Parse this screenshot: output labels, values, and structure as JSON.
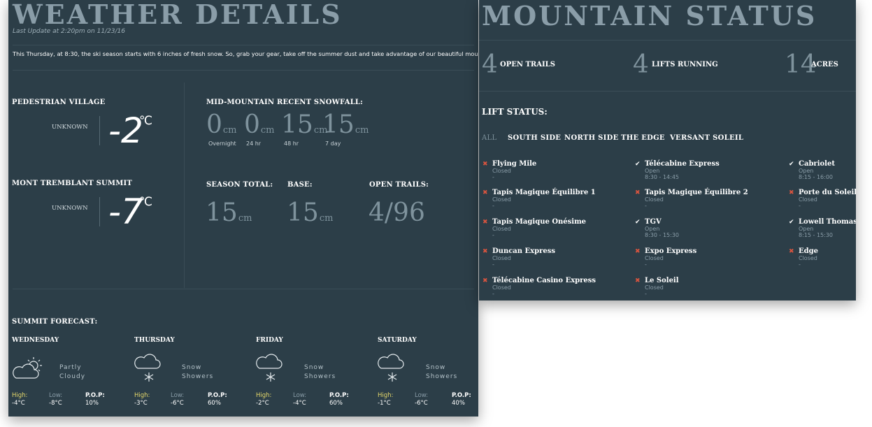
{
  "colors": {
    "panel": "#2c3e48",
    "open": "#ffffff",
    "closed": "#d9543f",
    "high_label": "#e7d96b"
  },
  "weather": {
    "title": "WEATHER DETAILS",
    "last_update": "Last Update at 2:20pm on 11/23/16",
    "announcement": "This Thursday, at 8:30, the ski season starts with 6 inches of fresh snow. So, grab your gear, take off the summer dust and take advantage of our beautiful mountain!",
    "village": {
      "label": "PEDESTRIAN VILLAGE",
      "condition": "UNKNOWN",
      "temp": "-2",
      "unit": "℃"
    },
    "summit": {
      "label": "MONT TREMBLANT SUMMIT",
      "condition": "UNKNOWN",
      "temp": "-7",
      "unit": "℃"
    },
    "snowfall": {
      "label": "MID-MOUNTAIN RECENT SNOWFALL:",
      "items": [
        {
          "value": "0",
          "unit": "cm",
          "period": "Overnight"
        },
        {
          "value": "0",
          "unit": "cm",
          "period": "24 hr"
        },
        {
          "value": "15",
          "unit": "cm",
          "period": "48 hr"
        },
        {
          "value": "15",
          "unit": "cm",
          "period": "7 day"
        }
      ]
    },
    "season_total": {
      "label": "SEASON TOTAL:",
      "value": "15",
      "unit": "cm"
    },
    "base": {
      "label": "BASE:",
      "value": "15",
      "unit": "cm"
    },
    "open_trails": {
      "label": "OPEN TRAILS:",
      "value": "4/96"
    },
    "forecast": {
      "label": "SUMMIT FORECAST:",
      "days": [
        {
          "day": "WEDNESDAY",
          "icon": "partly-cloudy-icon",
          "desc1": "Partly",
          "desc2": "Cloudy",
          "high_label": "High:",
          "high": "-4°C",
          "low_label": "Low:",
          "low": "-8°C",
          "pop_label": "P.O.P:",
          "pop": "10%"
        },
        {
          "day": "THURSDAY",
          "icon": "snow-showers-icon",
          "desc1": "Snow",
          "desc2": "Showers",
          "high_label": "High:",
          "high": "-3°C",
          "low_label": "Low:",
          "low": "-6°C",
          "pop_label": "P.O.P:",
          "pop": "60%"
        },
        {
          "day": "FRIDAY",
          "icon": "snow-showers-icon",
          "desc1": "Snow",
          "desc2": "Showers",
          "high_label": "High:",
          "high": "-2°C",
          "low_label": "Low:",
          "low": "-4°C",
          "pop_label": "P.O.P:",
          "pop": "60%"
        },
        {
          "day": "SATURDAY",
          "icon": "snow-showers-icon",
          "desc1": "Snow",
          "desc2": "Showers",
          "high_label": "High:",
          "high": "-1°C",
          "low_label": "Low:",
          "low": "-6°C",
          "pop_label": "P.O.P:",
          "pop": "40%"
        }
      ]
    }
  },
  "mountain": {
    "title": "MOUNTAIN STATUS",
    "stats": [
      {
        "value": "4",
        "label": "OPEN TRAILS"
      },
      {
        "value": "4",
        "label": "LIFTS RUNNING"
      },
      {
        "value": "14",
        "label": "ACRES"
      }
    ],
    "lift_status_label": "LIFT STATUS:",
    "tabs": [
      "ALL",
      "SOUTH SIDE",
      "NORTH SIDE",
      "THE EDGE",
      "VERSANT SOLEIL"
    ],
    "lifts": [
      {
        "name": "Flying Mile",
        "status": "Closed",
        "hours": "-",
        "open": false
      },
      {
        "name": "Télécabine Express",
        "status": "Open",
        "hours": "8:30 - 14:45",
        "open": true
      },
      {
        "name": "Cabriolet",
        "status": "Open",
        "hours": "8:15 - 16:00",
        "open": true
      },
      {
        "name": "Tapis Magique Équilibre 1",
        "status": "Closed",
        "hours": "-",
        "open": false
      },
      {
        "name": "Tapis Magique Équilibre 2",
        "status": "Closed",
        "hours": "-",
        "open": false
      },
      {
        "name": "Porte du Soleil",
        "status": "Closed",
        "hours": "-",
        "open": false
      },
      {
        "name": "Tapis Magique Onésime",
        "status": "Closed",
        "hours": "-",
        "open": false
      },
      {
        "name": "TGV",
        "status": "Open",
        "hours": "8:30 - 15:30",
        "open": true
      },
      {
        "name": "Lowell Thomas",
        "status": "Open",
        "hours": "8:15 - 15:30",
        "open": true
      },
      {
        "name": "Duncan Express",
        "status": "Closed",
        "hours": "-",
        "open": false
      },
      {
        "name": "Expo Express",
        "status": "Closed",
        "hours": "-",
        "open": false
      },
      {
        "name": "Edge",
        "status": "Closed",
        "hours": "-",
        "open": false
      },
      {
        "name": "Télécabine Casino Express",
        "status": "Closed",
        "hours": "-",
        "open": false
      },
      {
        "name": "Le Soleil",
        "status": "Closed",
        "hours": "-",
        "open": false
      }
    ]
  }
}
